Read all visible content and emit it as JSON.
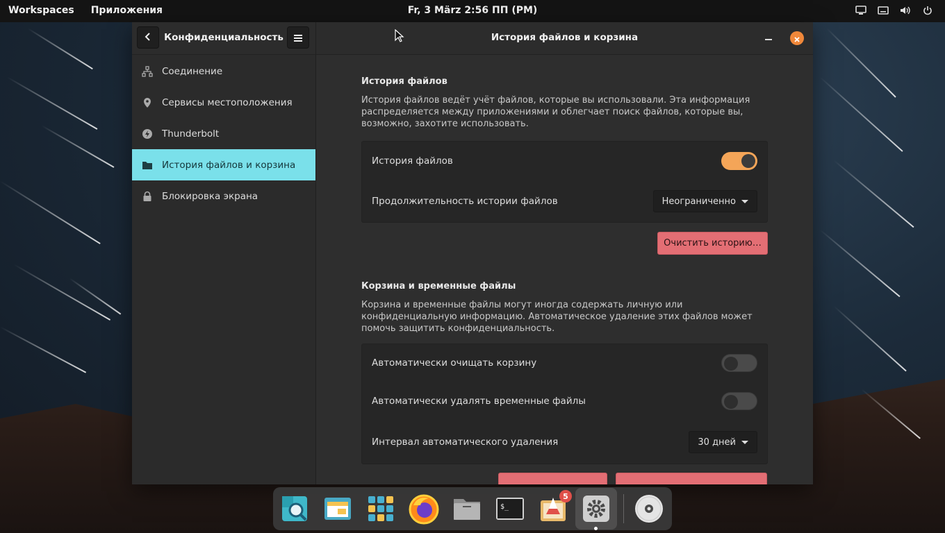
{
  "top_panel": {
    "workspaces_label": "Workspaces",
    "applications_label": "Приложения",
    "datetime": "Fr, 3 März   2:56 ПП (PM)",
    "tray_icons": [
      "screen-icon",
      "keyboard-icon",
      "volume-icon",
      "power-icon"
    ]
  },
  "sidebar": {
    "title": "Конфиденциальность",
    "back_icon": "chevron-left-icon",
    "menu_icon": "hamburger-menu-icon",
    "items": [
      {
        "label": "Соединение",
        "icon": "network-icon",
        "active": false
      },
      {
        "label": "Сервисы местоположения",
        "icon": "location-pin-icon",
        "active": false
      },
      {
        "label": "Thunderbolt",
        "icon": "thunderbolt-icon",
        "active": false
      },
      {
        "label": "История файлов и корзина",
        "icon": "folder-icon",
        "active": true
      },
      {
        "label": "Блокировка экрана",
        "icon": "lock-icon",
        "active": false
      }
    ]
  },
  "window": {
    "title": "История файлов и корзина"
  },
  "file_history": {
    "section_title": "История файлов",
    "description": "История файлов ведёт учёт файлов, которые вы использовали. Эта информация распределяется между приложениями и облегчает поиск файлов, которые вы, возможно, захотите использовать.",
    "toggle_label": "История файлов",
    "toggle_on": true,
    "duration_label": "Продолжительность истории файлов",
    "duration_value": "Неограниченно",
    "clear_button": "Очистить историю…"
  },
  "trash": {
    "section_title": "Корзина и временные файлы",
    "description": "Корзина и временные файлы могут иногда содержать личную или конфиденциальную информацию. Автоматическое удаление этих файлов может помочь защитить конфиденциальность.",
    "auto_trash_label": "Автоматически очищать корзину",
    "auto_trash_on": false,
    "auto_temp_label": "Автоматически удалять временные файлы",
    "auto_temp_on": false,
    "interval_label": "Интервал автоматического удаления",
    "interval_value": "30 дней"
  },
  "dock": {
    "apps": [
      "search-app-icon",
      "files-app-icon",
      "app-grid-icon",
      "firefox-icon",
      "file-manager-icon",
      "terminal-icon",
      "app-center-icon",
      "settings-icon",
      "disk-icon"
    ],
    "badge_count": "5"
  },
  "colors": {
    "accent": "#7ae0ea",
    "switch_on": "#f4a558",
    "destructive": "#e36e74",
    "close": "#f0883a"
  }
}
